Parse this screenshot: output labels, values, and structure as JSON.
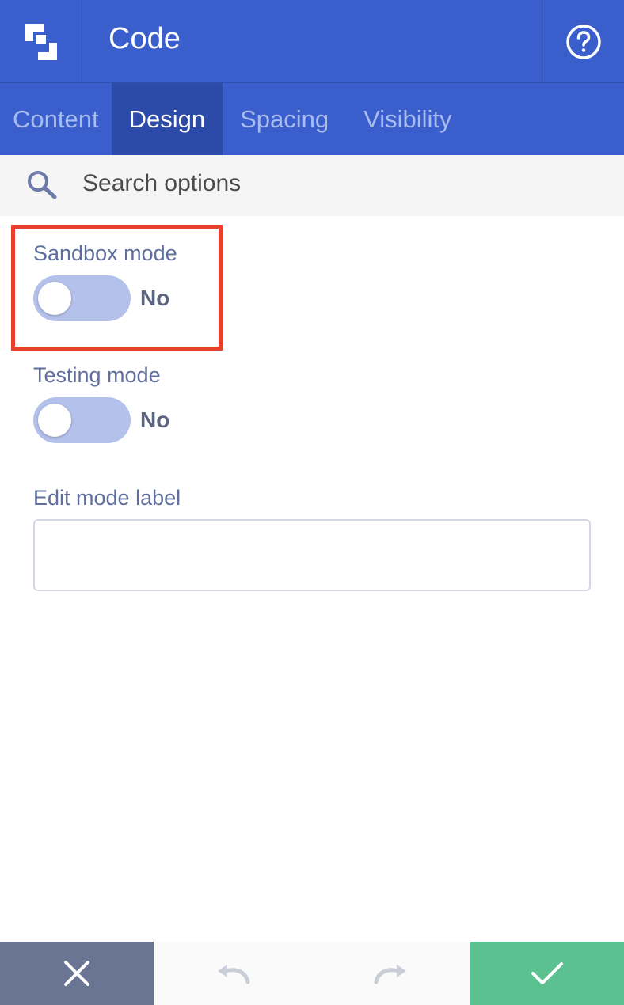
{
  "header": {
    "title": "Code",
    "logo_icon": "builder-logo-icon",
    "help_icon": "help-circle-icon"
  },
  "tabs": [
    {
      "label": "Content",
      "active": false
    },
    {
      "label": "Design",
      "active": true
    },
    {
      "label": "Spacing",
      "active": false
    },
    {
      "label": "Visibility",
      "active": false
    }
  ],
  "search": {
    "placeholder": "Search options",
    "value": "",
    "icon": "search-icon"
  },
  "fields": {
    "sandbox": {
      "label": "Sandbox mode",
      "state": "No",
      "on": false,
      "highlighted": true
    },
    "testing": {
      "label": "Testing mode",
      "state": "No",
      "on": false
    },
    "edit_label": {
      "label": "Edit mode label",
      "value": ""
    }
  },
  "footer": {
    "cancel_icon": "close-icon",
    "undo_icon": "undo-icon",
    "redo_icon": "redo-icon",
    "confirm_icon": "check-icon"
  },
  "colors": {
    "primary": "#3a5fcd",
    "tab_active": "#2c4aa8",
    "toggle_off": "#b4c1ea",
    "highlight": "#e8412b",
    "cancel": "#6a7593",
    "confirm": "#5bc191"
  }
}
